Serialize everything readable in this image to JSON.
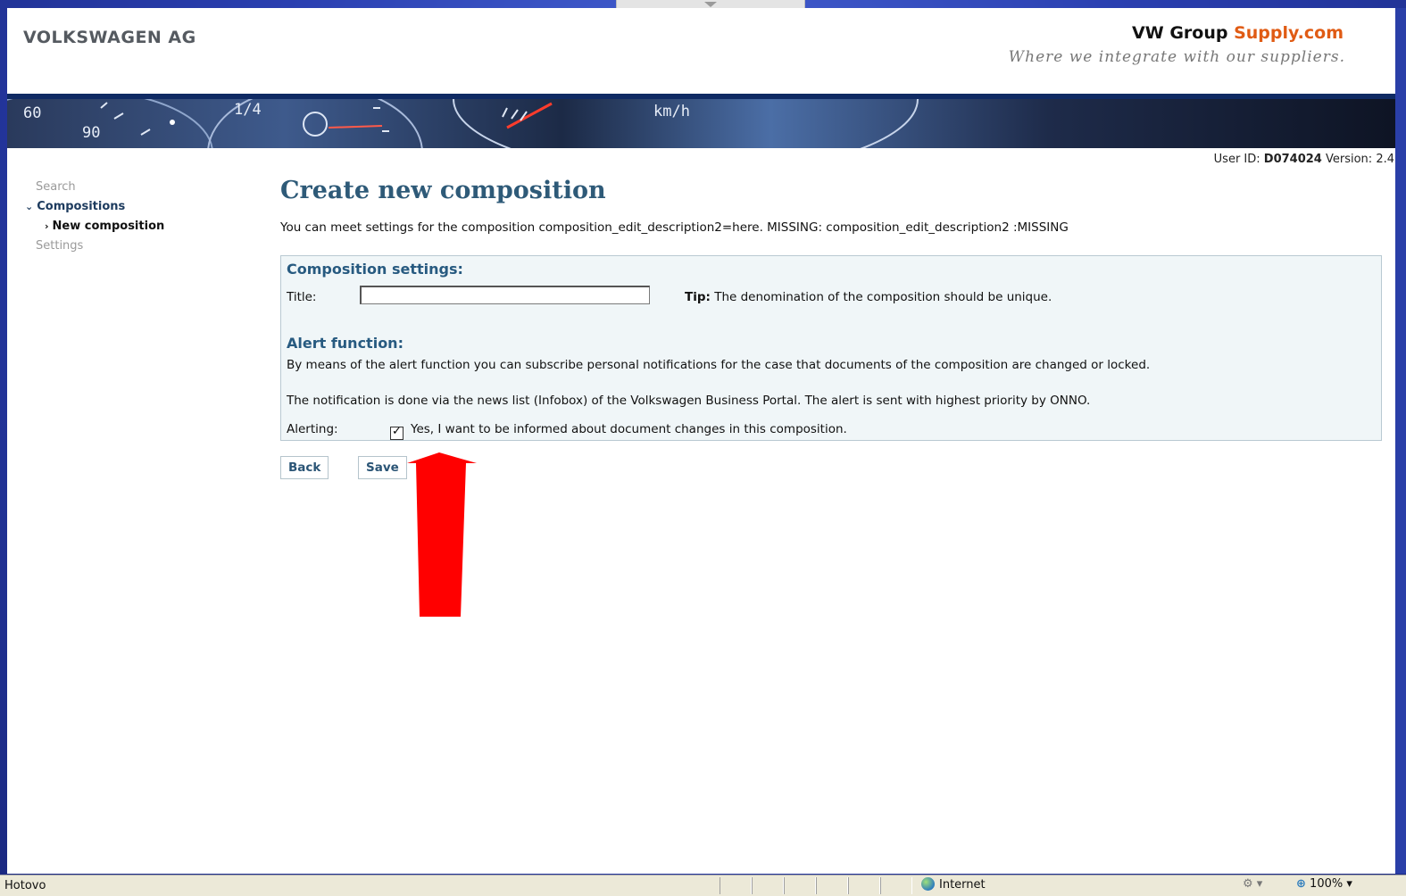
{
  "header": {
    "company": "VOLKSWAGEN AG",
    "brand_main": "VW Group ",
    "brand_accent": "Supply.com",
    "tagline": "Where we integrate with our suppliers."
  },
  "banner": {
    "gauge_labels": [
      "60",
      "90",
      "1/4",
      "km/h"
    ]
  },
  "user": {
    "label": "User ID: ",
    "id": "D074024",
    "version_label": " Version: ",
    "version": "2.4"
  },
  "sidebar": {
    "items": [
      {
        "label": "Search"
      },
      {
        "label": "Compositions"
      },
      {
        "label": "New composition"
      },
      {
        "label": "Settings"
      }
    ]
  },
  "main": {
    "title": "Create new composition",
    "description": "You can meet settings for the composition composition_edit_description2=here. MISSING: composition_edit_description2 :MISSING",
    "settings_heading": "Composition settings:",
    "title_label": "Title:",
    "title_value": "",
    "tip_label": "Tip:",
    "tip_text": " The denomination of the composition should be unique.",
    "alert_heading": "Alert function:",
    "alert_para1": "By means of the alert function you can subscribe personal notifications for the case that documents of the composition are changed or locked.",
    "alert_para2": "The notification is done via the news list (Infobox) of the Volkswagen Business Portal. The alert is sent with highest priority by ONNO.",
    "alerting_label": "Alerting:",
    "alerting_checked": true,
    "alerting_text": "Yes, I want to be informed about document changes in this composition.",
    "back_label": "Back",
    "save_label": "Save"
  },
  "statusbar": {
    "status": "Hotovo",
    "zone": "Internet",
    "zoom": "100%"
  },
  "colors": {
    "title": "#2e5a78",
    "accent": "#e05b14",
    "annotation_arrow": "#ff0000"
  }
}
